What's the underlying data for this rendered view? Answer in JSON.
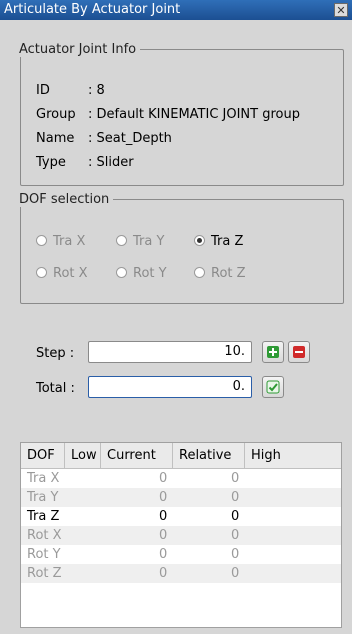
{
  "window": {
    "title": "Articulate By Actuator Joint",
    "close_glyph": "✕"
  },
  "info": {
    "legend": "Actuator Joint Info",
    "rows": [
      {
        "label": "ID",
        "value": ": 8"
      },
      {
        "label": "Group",
        "value": ": Default KINEMATIC JOINT group"
      },
      {
        "label": "Name",
        "value": ": Seat_Depth"
      },
      {
        "label": "Type",
        "value": ": Slider"
      }
    ]
  },
  "dof": {
    "legend": "DOF selection",
    "options": [
      "Tra X",
      "Tra Y",
      "Tra Z",
      "Rot X",
      "Rot Y",
      "Rot Z"
    ],
    "selected": "Tra Z"
  },
  "step": {
    "label": "Step :",
    "value": "10."
  },
  "total": {
    "label": "Total :",
    "value": "0."
  },
  "table": {
    "columns": [
      "DOF",
      "Low",
      "Current",
      "Relative",
      "High"
    ],
    "rows": [
      {
        "dof": "Tra X",
        "low": "",
        "current": "0",
        "relative": "0",
        "high": ""
      },
      {
        "dof": "Tra Y",
        "low": "",
        "current": "0",
        "relative": "0",
        "high": ""
      },
      {
        "dof": "Tra Z",
        "low": "",
        "current": "0",
        "relative": "0",
        "high": ""
      },
      {
        "dof": "Rot X",
        "low": "",
        "current": "0",
        "relative": "0",
        "high": ""
      },
      {
        "dof": "Rot Y",
        "low": "",
        "current": "0",
        "relative": "0",
        "high": ""
      },
      {
        "dof": "Rot Z",
        "low": "",
        "current": "0",
        "relative": "0",
        "high": ""
      }
    ]
  },
  "icons": {
    "increment": "plus-icon",
    "decrement": "minus-icon",
    "apply": "checkmark-icon"
  },
  "colors": {
    "titlebar": "#1f56a0",
    "plus": "#2e9a35",
    "minus": "#d02a2a",
    "check": "#2e9a35"
  }
}
